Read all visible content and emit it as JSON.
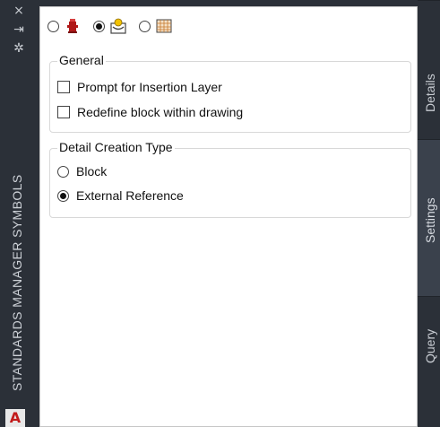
{
  "palette": {
    "strip_bg": "#2b3038",
    "panel_bg": "#ffffff",
    "group_border": "#d8d8d8",
    "logo_red": "#c21b1b",
    "active_tab_bg": "#3a414c"
  },
  "left_strip": {
    "close_glyph": "×",
    "pin_glyph": "⇥",
    "settings_glyph": "✲",
    "title": "STANDARDS MANAGER SYMBOLS",
    "logo_text": "A"
  },
  "toolbar": {
    "items": [
      {
        "icon": "fire-hydrant-icon",
        "selected": false
      },
      {
        "icon": "detail-symbol-icon",
        "selected": true
      },
      {
        "icon": "pattern-grid-icon",
        "selected": false
      }
    ]
  },
  "general": {
    "title": "General",
    "prompt_insertion_layer": {
      "label": "Prompt for Insertion Layer",
      "checked": false
    },
    "redefine_block": {
      "label": "Redefine block within drawing",
      "checked": false
    }
  },
  "detail_creation": {
    "title": "Detail Creation Type",
    "options": [
      {
        "label": "Block",
        "selected": false
      },
      {
        "label": "External Reference",
        "selected": true
      }
    ]
  },
  "tabs": [
    {
      "label": "Details",
      "active": false
    },
    {
      "label": "Settings",
      "active": true
    },
    {
      "label": "Query",
      "active": false
    }
  ]
}
